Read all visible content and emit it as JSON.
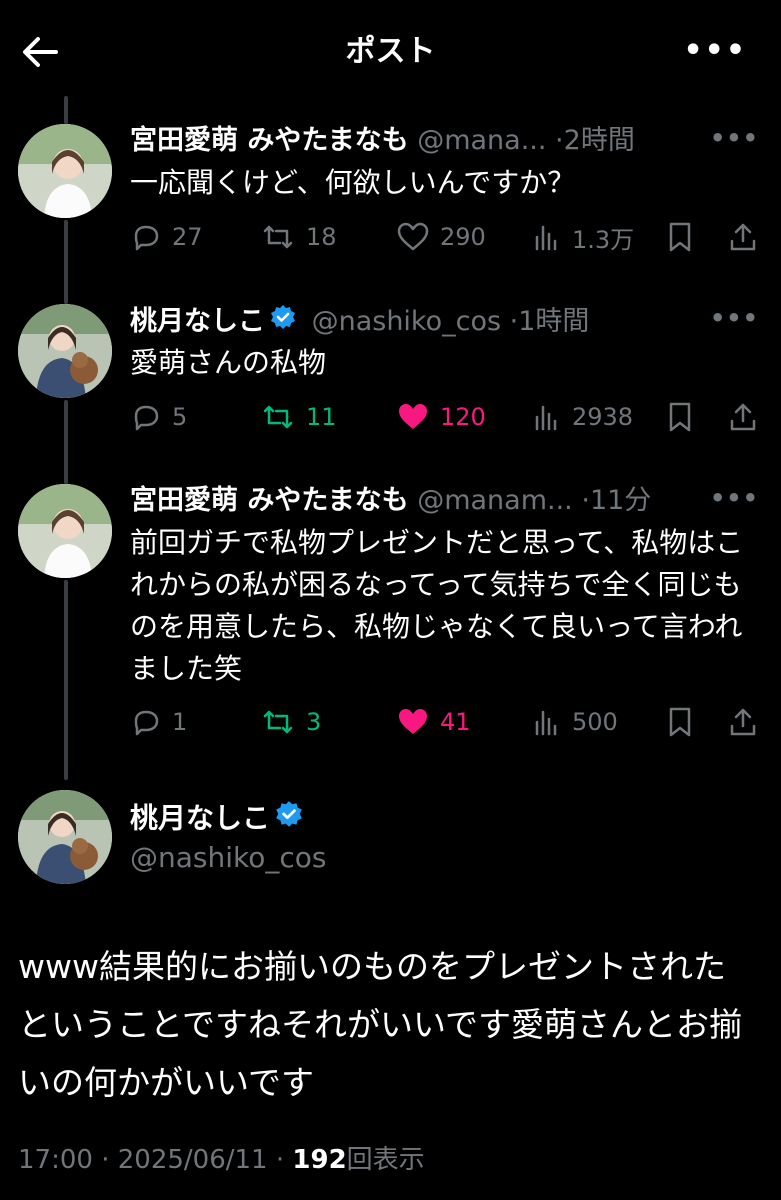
{
  "header": {
    "title": "ポスト",
    "back_icon": "arrow-left-icon",
    "more_icon": "more-icon"
  },
  "tweets": [
    {
      "name": "宮田愛萌 みやたまなも",
      "handle": "@mana...",
      "sep": "·",
      "time": "2時間",
      "verified": false,
      "text": "一応聞くけど、何欲しいんですか？",
      "replies": "27",
      "retweets": "18",
      "likes": "290",
      "views": "1.3万",
      "liked": false,
      "retweeted": false
    },
    {
      "name": "桃月なしこ",
      "handle": "@nashiko_cos",
      "sep": "·",
      "time": "1時間",
      "verified": true,
      "text": "愛萌さんの私物",
      "replies": "5",
      "retweets": "11",
      "likes": "120",
      "views": "2938",
      "liked": true,
      "retweeted": true
    },
    {
      "name": "宮田愛萌 みやたまなも",
      "handle": "@manam...",
      "sep": "·",
      "time": "11分",
      "verified": false,
      "text": "前回ガチで私物プレゼントだと思って、私物はこれからの私が困るなってって気持ちで全く同じものを用意したら、私物じゃなくて良いって言われました笑",
      "replies": "1",
      "retweets": "3",
      "likes": "41",
      "views": "500",
      "liked": true,
      "retweeted": true
    }
  ],
  "focus": {
    "name": "桃月なしこ",
    "handle": "@nashiko_cos",
    "verified": true,
    "text": "www結果的にお揃いのものをプレゼントされたということですねそれがいいです愛萌さんとお揃いの何かがいいです",
    "time": "17:00",
    "sep1": "·",
    "date": "2025/06/11",
    "sep2": "·",
    "views": "192",
    "views_label": "回表示"
  },
  "colors": {
    "like": "#f91880",
    "retweet": "#00ba7c",
    "muted": "#71767b",
    "verified": "#1d9bf0"
  }
}
